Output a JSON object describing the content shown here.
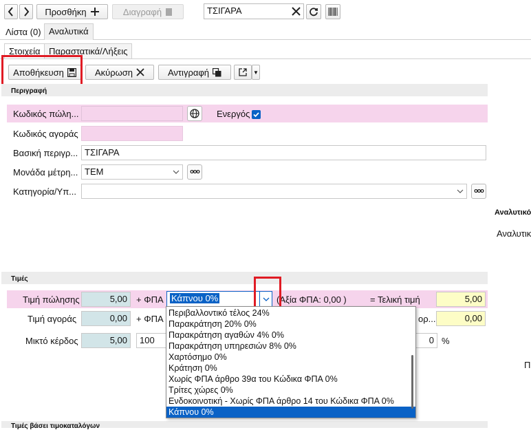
{
  "toolbar": {
    "prev_icon": "chevron-left-icon",
    "next_icon": "chevron-right-icon",
    "add_label": "Προσθήκη",
    "delete_label": "Διαγραφή",
    "search_value": "ΤΣΙΓΑΡΑ"
  },
  "tabs": {
    "list_label": "Λίστα (0)",
    "details_label": "Αναλυτικά"
  },
  "subtabs": {
    "info_label": "Στοιχεία",
    "docs_label": "Παραστατικά/Λήξεις"
  },
  "actions": {
    "save_label": "Αποθήκευση",
    "cancel_label": "Ακύρωση",
    "copy_label": "Αντιγραφή"
  },
  "sections": {
    "description": "Περιγραφή",
    "prices": "Τιμές",
    "consumer_prices": "Τιμές βάσει τιμοκαταλόγων"
  },
  "form": {
    "sell_code_label": "Κωδικός πώλη...",
    "sell_code_value": "",
    "active_label": "Ενεργός",
    "buy_code_label": "Κωδικός αγοράς",
    "buy_code_value": "",
    "basic_desc_label": "Βασική περιγρ...",
    "basic_desc_value": "ΤΣΙΓΑΡΑ",
    "unit_label": "Μονάδα μέτρη...",
    "unit_value": "ΤΕΜ",
    "category_label": "Κατηγορία/Υπ...",
    "category_value": "",
    "dots_label": "ooo"
  },
  "right_panel": {
    "header": "Αναλυτικό",
    "item": "Αναλυτικ",
    "stray_letter": "Π"
  },
  "prices": {
    "sell_price_label": "Τιμή πώλησης",
    "sell_price_value": "5,00",
    "vat_label": "+ ΦΠΑ",
    "vat_selected": "Κάπνου 0%",
    "vat_amount": "(Αξία ΦΠΑ: 0,00 )",
    "final_price_label": "= Τελική τιμή",
    "final_price_value": "5,00",
    "buy_price_label": "Τιμή αγοράς",
    "buy_price_value": "0,00",
    "vat2_label": "+ ΦΠΑ",
    "buy_final_partial": "ορ...",
    "buy_final_value": "0,00",
    "gross_profit_label": "Μικτό κέρδος",
    "gross_profit_value": "5,00",
    "profit_partial": "100",
    "percent_value": "0",
    "percent_sign": "%"
  },
  "dropdown": {
    "items": [
      "Περιβαλλοντικό τέλος 24%",
      "Παρακράτηση 20% 0%",
      "Παρακράτηση αγαθών 4% 0%",
      "Παρακράτηση υπηρεσιών 8% 0%",
      "Χαρτόσημο 0%",
      "Κράτηση 0%",
      "Χωρίς ΦΠΑ άρθρο 39α του Κώδικα ΦΠΑ 0%",
      "Τρίτες χώρες 0%",
      "Ενδοκοινοτική - Χωρίς ΦΠΑ άρθρο 14 του Κώδικα ΦΠΑ 0%",
      "Κάπνου 0%"
    ],
    "selected_index": 9
  },
  "colors": {
    "accent": "#0a62c6",
    "highlight_red": "#e01b24"
  }
}
